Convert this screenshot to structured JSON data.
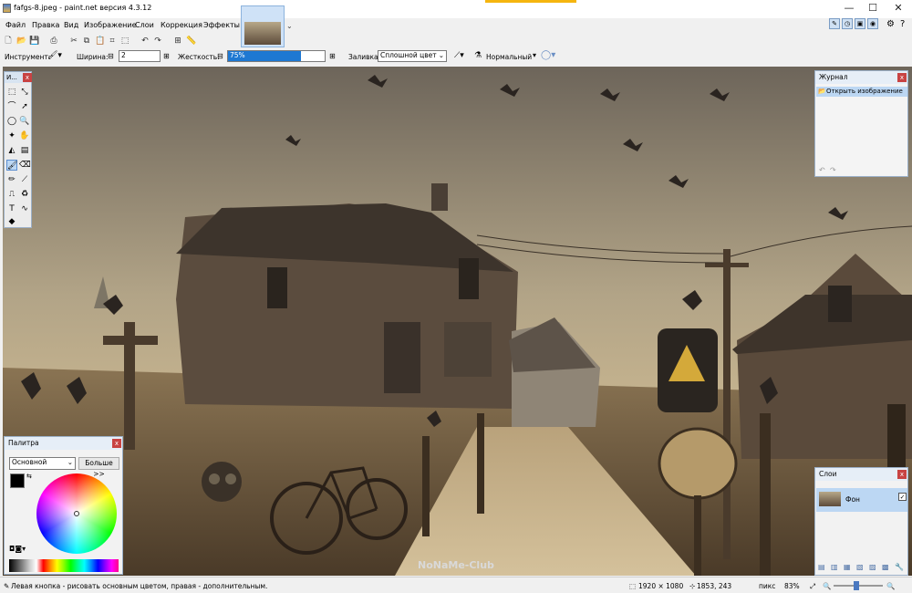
{
  "window": {
    "title": "fafgs-8.jpeg - paint.net версия 4.3.12",
    "minimize": "—",
    "maximize": "☐",
    "close": "✕"
  },
  "menu": [
    "Файл",
    "Правка",
    "Вид",
    "Изображение",
    "Слои",
    "Коррекция",
    "Эффекты"
  ],
  "doc_tab_dropdown": "⌄",
  "toolbar": {
    "tool_label": "Инструмент:",
    "width_label": "Ширина:",
    "width_value": "2",
    "hardness_label": "Жесткость:",
    "hardness_value": "75%",
    "hardness_fraction": 0.75,
    "fill_label": "Заливка:",
    "fill_value": "Сплошной цвет",
    "blend_mode": "Нормальный"
  },
  "tools_panel": {
    "title": "И...",
    "close": "x"
  },
  "history_panel": {
    "title": "Журнал",
    "close": "x",
    "items": [
      "Открыть изображение"
    ]
  },
  "palette_panel": {
    "title": "Палитра",
    "close": "x",
    "palette_select": "Основной",
    "more_button": "Больше >>"
  },
  "layers_panel": {
    "title": "Слои",
    "close": "x",
    "layers": [
      {
        "name": "Фон",
        "visible": true
      }
    ]
  },
  "status": {
    "hint": "Левая кнопка - рисовать основным цветом, правая - дополнительным.",
    "image_size": "1920 × 1080",
    "cursor_pos": "1853, 243",
    "units": "пикс",
    "zoom": "83%"
  },
  "watermark": "NoNaMe-Club",
  "colors": {
    "accent": "#f5b50f",
    "selection": "#bcd7f3",
    "hardness_fill": "#1e78d2",
    "close_red": "#c84343"
  }
}
